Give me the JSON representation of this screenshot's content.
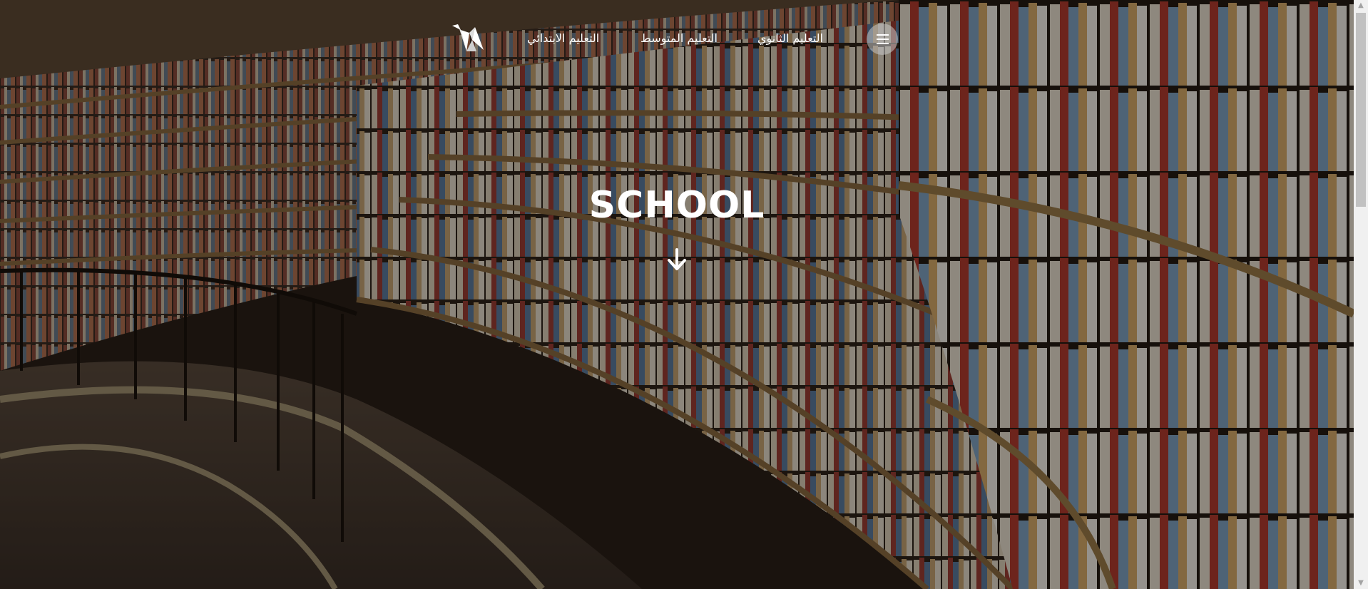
{
  "nav": {
    "logo_icon": "origami-bird-icon",
    "links": [
      {
        "label": "التعليم الابتدائي"
      },
      {
        "label": "التعليم المتوسط"
      },
      {
        "label": "التعليم الثانوي"
      }
    ],
    "menu_icon": "hamburger-menu-icon"
  },
  "hero": {
    "title": "SCHOOL",
    "scroll_icon": "arrow-down-icon",
    "background": "library-bookshelves-image"
  },
  "colors": {
    "text": "#ffffff",
    "overlay": "rgba(0,0,0,0.38)",
    "menu_button": "#c8c8c8"
  }
}
